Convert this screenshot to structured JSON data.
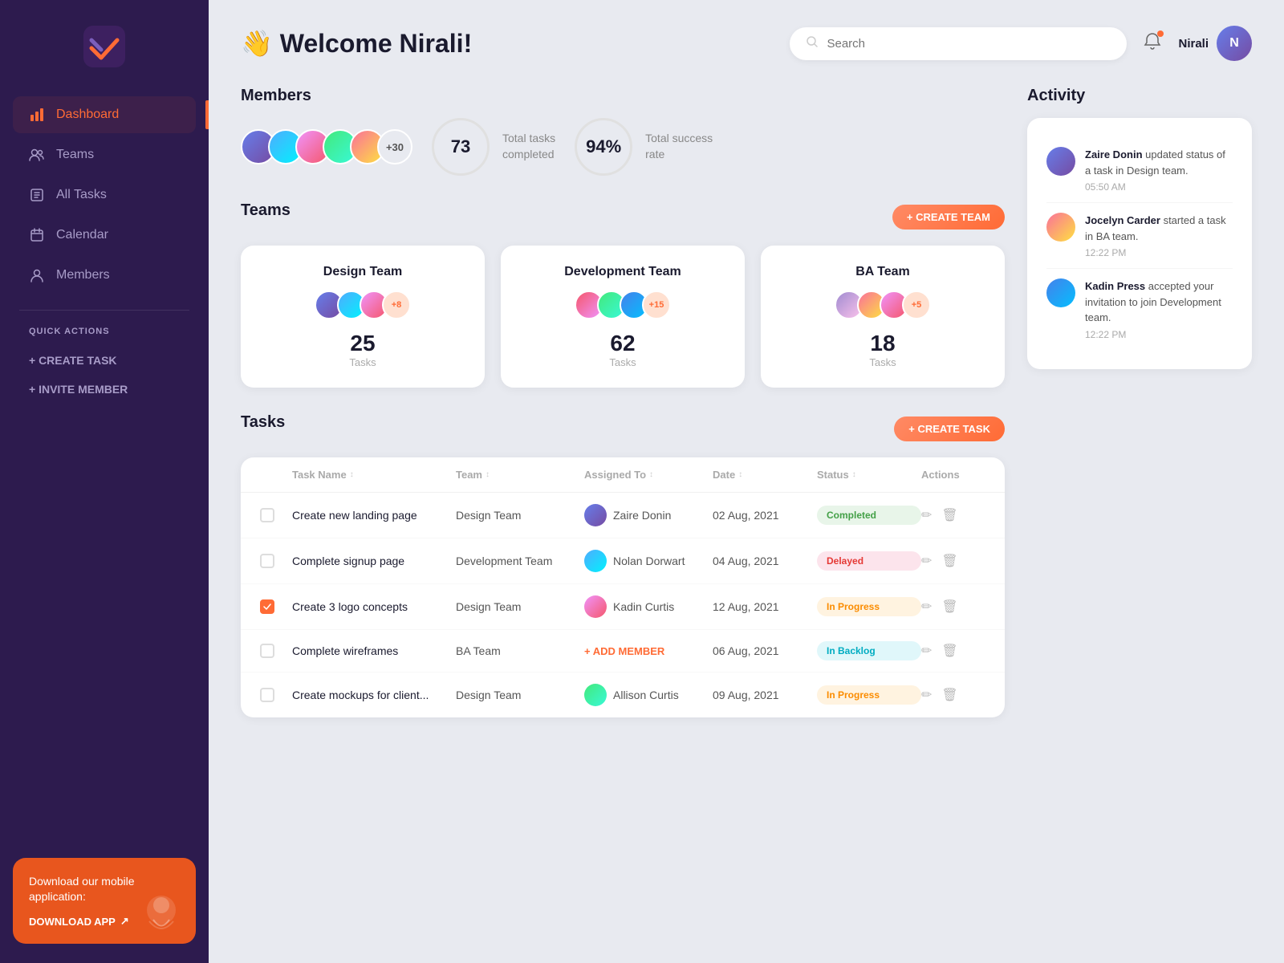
{
  "sidebar": {
    "logo_alt": "TaskFlow Logo",
    "nav_items": [
      {
        "id": "dashboard",
        "label": "Dashboard",
        "icon": "bar-chart-icon",
        "active": true
      },
      {
        "id": "teams",
        "label": "Teams",
        "icon": "teams-icon",
        "active": false
      },
      {
        "id": "alltasks",
        "label": "All Tasks",
        "icon": "tasks-icon",
        "active": false
      },
      {
        "id": "calendar",
        "label": "Calendar",
        "icon": "calendar-icon",
        "active": false
      },
      {
        "id": "members",
        "label": "Members",
        "icon": "members-icon",
        "active": false
      }
    ],
    "quick_actions_label": "QUICK ACTIONS",
    "create_task_label": "+ CREATE TASK",
    "invite_member_label": "+ INVITE MEMBER",
    "download_card": {
      "text": "Download our mobile application:",
      "button_label": "DOWNLOAD APP"
    }
  },
  "header": {
    "welcome": "👋 Welcome Nirali!",
    "search_placeholder": "Search",
    "user_name": "Nirali"
  },
  "members_section": {
    "title": "Members",
    "extra_count": "+30",
    "stats": [
      {
        "value": "73",
        "label": "Total tasks\ncompleted"
      },
      {
        "value": "94%",
        "label": "Total success\nrate"
      }
    ]
  },
  "teams_section": {
    "title": "Teams",
    "create_btn": "+ CREATE TEAM",
    "teams": [
      {
        "id": "design",
        "name": "Design Team",
        "extra": "+8",
        "tasks_count": "25",
        "tasks_label": "Tasks"
      },
      {
        "id": "development",
        "name": "Development Team",
        "extra": "+15",
        "tasks_count": "62",
        "tasks_label": "Tasks"
      },
      {
        "id": "ba",
        "name": "BA Team",
        "extra": "+5",
        "tasks_count": "18",
        "tasks_label": "Tasks"
      }
    ]
  },
  "tasks_section": {
    "title": "Tasks",
    "create_btn": "+ CREATE TASK",
    "columns": [
      {
        "id": "checkbox",
        "label": ""
      },
      {
        "id": "name",
        "label": "Task Name"
      },
      {
        "id": "team",
        "label": "Team"
      },
      {
        "id": "assignee",
        "label": "Assigned To"
      },
      {
        "id": "date",
        "label": "Date"
      },
      {
        "id": "status",
        "label": "Status"
      },
      {
        "id": "actions",
        "label": "Actions"
      }
    ],
    "rows": [
      {
        "id": 1,
        "checked": false,
        "name": "Create new landing page",
        "team": "Design Team",
        "assignee": "Zaire Donin",
        "assignee_av": "av-purple",
        "date": "02 Aug, 2021",
        "status": "Completed",
        "status_class": "status-completed"
      },
      {
        "id": 2,
        "checked": false,
        "name": "Complete signup page",
        "team": "Development Team",
        "assignee": "Nolan Dorwart",
        "assignee_av": "av-teal",
        "date": "04 Aug, 2021",
        "status": "Delayed",
        "status_class": "status-delayed"
      },
      {
        "id": 3,
        "checked": true,
        "name": "Create 3 logo concepts",
        "team": "Design Team",
        "assignee": "Kadin Curtis",
        "assignee_av": "av-orange",
        "date": "12 Aug, 2021",
        "status": "In Progress",
        "status_class": "status-inprogress"
      },
      {
        "id": 4,
        "checked": false,
        "name": "Complete wireframes",
        "team": "BA Team",
        "assignee": null,
        "assignee_av": null,
        "date": "06 Aug, 2021",
        "status": "In Backlog",
        "status_class": "status-backlog"
      },
      {
        "id": 5,
        "checked": false,
        "name": "Create mockups for client...",
        "team": "Design Team",
        "assignee": "Allison Curtis",
        "assignee_av": "av-green",
        "date": "09 Aug, 2021",
        "status": "In Progress",
        "status_class": "status-inprogress"
      }
    ]
  },
  "activity_section": {
    "title": "Activity",
    "items": [
      {
        "id": 1,
        "name": "Zaire Donin",
        "action": "updated status of a task in Design team.",
        "time": "05:50 AM",
        "av": "av-purple"
      },
      {
        "id": 2,
        "name": "Jocelyn Carder",
        "action": "started a task in BA team.",
        "time": "12:22 PM",
        "av": "av-pink"
      },
      {
        "id": 3,
        "name": "Kadin Press",
        "action": "accepted your invitation to join Development team.",
        "time": "12:22 PM",
        "av": "av-blue"
      }
    ]
  },
  "add_member_label": "+ ADD MEMBER"
}
